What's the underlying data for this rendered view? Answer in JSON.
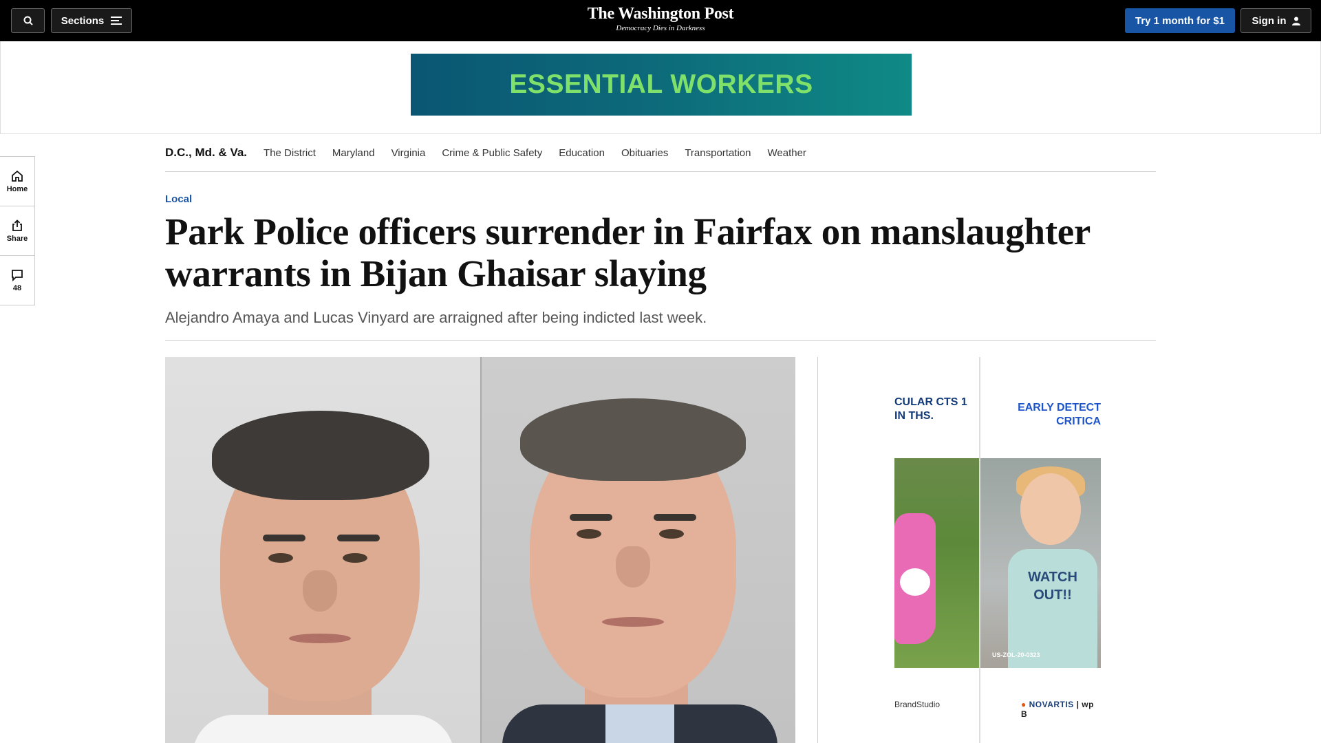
{
  "header": {
    "sections_label": "Sections",
    "masthead": "The Washington Post",
    "tagline": "Democracy Dies in Darkness",
    "trial_label": "Try 1 month for $1",
    "signin_label": "Sign in"
  },
  "ad_banner": {
    "text": "ESSENTIAL WORKERS"
  },
  "section_nav": {
    "title": "D.C., Md. & Va.",
    "links": [
      "The District",
      "Maryland",
      "Virginia",
      "Crime & Public Safety",
      "Education",
      "Obituaries",
      "Transportation",
      "Weather"
    ]
  },
  "left_rail": {
    "home_label": "Home",
    "share_label": "Share",
    "comments_count": "48"
  },
  "article": {
    "kicker": "Local",
    "headline": "Park Police officers surrender in Fairfax on manslaughter warrants in Bijan Ghaisar slaying",
    "dek": "Alejandro Amaya and Lucas Vinyard are arraigned after being indicted last week."
  },
  "side_ad": {
    "text_left": "CULAR CTS 1 IN THS.",
    "text_right": "EARLY DETECT CRITICA",
    "shirt_text_1": "WATCH",
    "shirt_text_2": "OUT!!",
    "code": "US-ZOL-20-0323",
    "footer_left": "BrandStudio",
    "footer_brand": "NOVARTIS",
    "footer_partner": "wp B"
  },
  "colors": {
    "topbar": "#000000",
    "accent_blue": "#1955a5",
    "banner_text": "#7fe06a"
  }
}
